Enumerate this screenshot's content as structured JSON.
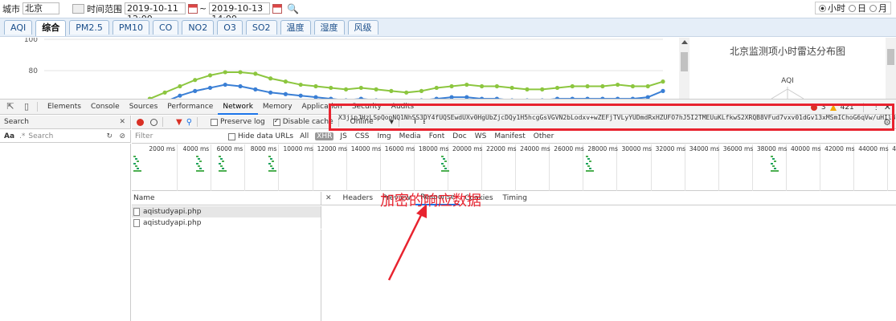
{
  "filter": {
    "city_label": "城市",
    "city_value": "北京",
    "range_label": "时间范围",
    "start_value": "2019-10-11 12:00",
    "tilde": "~",
    "end_value": "2019-10-13 14:00",
    "granularity": [
      {
        "label": "小时",
        "checked": true
      },
      {
        "label": "日",
        "checked": false
      },
      {
        "label": "月",
        "checked": false
      }
    ]
  },
  "page_tabs": [
    {
      "label": "AQI",
      "active": false
    },
    {
      "label": "综合",
      "active": true
    },
    {
      "label": "PM2.5",
      "active": false
    },
    {
      "label": "PM10",
      "active": false
    },
    {
      "label": "CO",
      "active": false
    },
    {
      "label": "NO2",
      "active": false
    },
    {
      "label": "O3",
      "active": false
    },
    {
      "label": "SO2",
      "active": false
    },
    {
      "label": "温度",
      "active": false
    },
    {
      "label": "湿度",
      "active": false
    },
    {
      "label": "风级",
      "active": false
    }
  ],
  "chart_data": {
    "type": "line",
    "title": "",
    "y_ticks": [
      80,
      100
    ],
    "ylim": [
      60,
      100
    ],
    "series": [
      {
        "color": "#8cc63f",
        "values": [
          55,
          56,
          58,
          62,
          66,
          70,
          74,
          77,
          79,
          79,
          78,
          75,
          73,
          71,
          70,
          69,
          68,
          69,
          68,
          67,
          66,
          67,
          69,
          70,
          71,
          70,
          70,
          69,
          68,
          68,
          69,
          70,
          70,
          70,
          71,
          70,
          70,
          73
        ]
      },
      {
        "color": "#3a7fd5",
        "values": [
          52,
          53,
          54,
          56,
          60,
          64,
          67,
          69,
          71,
          70,
          68,
          66,
          65,
          64,
          63,
          62,
          61,
          62,
          61,
          60,
          60,
          61,
          62,
          63,
          63,
          62,
          62,
          61,
          61,
          61,
          62,
          62,
          62,
          62,
          62,
          62,
          63,
          67
        ]
      }
    ]
  },
  "radar": {
    "title": "北京监测项小时雷达分布图",
    "axis_aqi": "AQI"
  },
  "devtools": {
    "tabs": [
      "Elements",
      "Console",
      "Sources",
      "Performance",
      "Network",
      "Memory",
      "Application",
      "Security",
      "Audits"
    ],
    "active_tab": "Network",
    "errors": "3",
    "warnings": "421",
    "search_panel": {
      "title": "Search",
      "aa": "Aa",
      "regex": ".*",
      "placeholder": "Search"
    },
    "network": {
      "preserve_log": "Preserve log",
      "disable_cache": "Disable cache",
      "throttle": "Online",
      "filter_placeholder": "Filter",
      "hide_data_urls": "Hide data URLs",
      "types": [
        "All",
        "XHR",
        "JS",
        "CSS",
        "Img",
        "Media",
        "Font",
        "Doc",
        "WS",
        "Manifest",
        "Other"
      ],
      "active_type": "XHR",
      "timeline": [
        "2000 ms",
        "4000 ms",
        "6000 ms",
        "8000 ms",
        "10000 ms",
        "12000 ms",
        "14000 ms",
        "16000 ms",
        "18000 ms",
        "20000 ms",
        "22000 ms",
        "24000 ms",
        "26000 ms",
        "28000 ms",
        "30000 ms",
        "32000 ms",
        "34000 ms",
        "36000 ms",
        "38000 ms",
        "40000 ms",
        "42000 ms",
        "44000 ms",
        "4("
      ],
      "name_header": "Name",
      "requests": [
        "aqistudyapi.php",
        "aqistudyapi.php"
      ],
      "detail_tabs": [
        "Headers",
        "Preview",
        "Response",
        "Cookies",
        "Timing"
      ],
      "active_detail": "Response",
      "response_line_no": "1",
      "response_text": "X3jipJHzLSpQopNQ1NhSS3DY4fUQSEwdUXv0HgUbZjcDQy1H5hcgGsVGVN2bLodxv+wZEFjTVLyYUDmdRxHZUFO7hJ5I2TMEUuKLfkwS2XRQB8VFud7vxv01dGv13xMSmIChoG6qVw/uHIl3pNfH6Ciy7ZyRJzrM"
    }
  },
  "annotation": "加密的响应数据"
}
